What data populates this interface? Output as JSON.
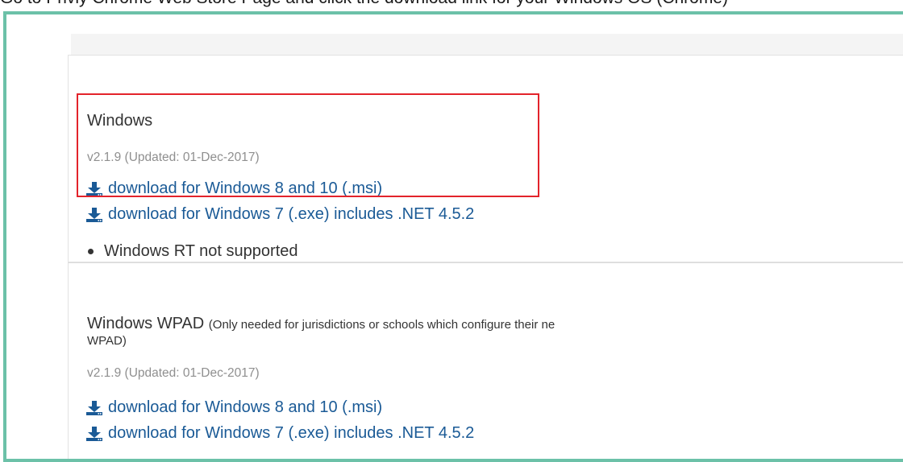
{
  "caption": "Go to Privly Chrome Web Store Page and click the download link for your Windows OS (Chrome)",
  "sections": [
    {
      "title": "Windows",
      "note": "",
      "version": "v2.1.9 (Updated: 01-Dec-2017)",
      "links": [
        "download for Windows 8 and 10 (.msi)",
        "download for Windows 7 (.exe) includes .NET 4.5.2"
      ],
      "bullet": "Windows RT not supported"
    },
    {
      "title": "Windows WPAD",
      "note": "(Only needed for jurisdictions or schools which configure their ne",
      "title_line2": "WPAD)",
      "version": "v2.1.9 (Updated: 01-Dec-2017)",
      "links": [
        "download for Windows 8 and 10 (.msi)",
        "download for Windows 7 (.exe) includes .NET 4.5.2"
      ]
    }
  ],
  "colors": {
    "frame": "#6cc1a8",
    "link": "#1a5a96",
    "highlight": "#e3232b"
  },
  "icons": {
    "download": "download-icon"
  }
}
